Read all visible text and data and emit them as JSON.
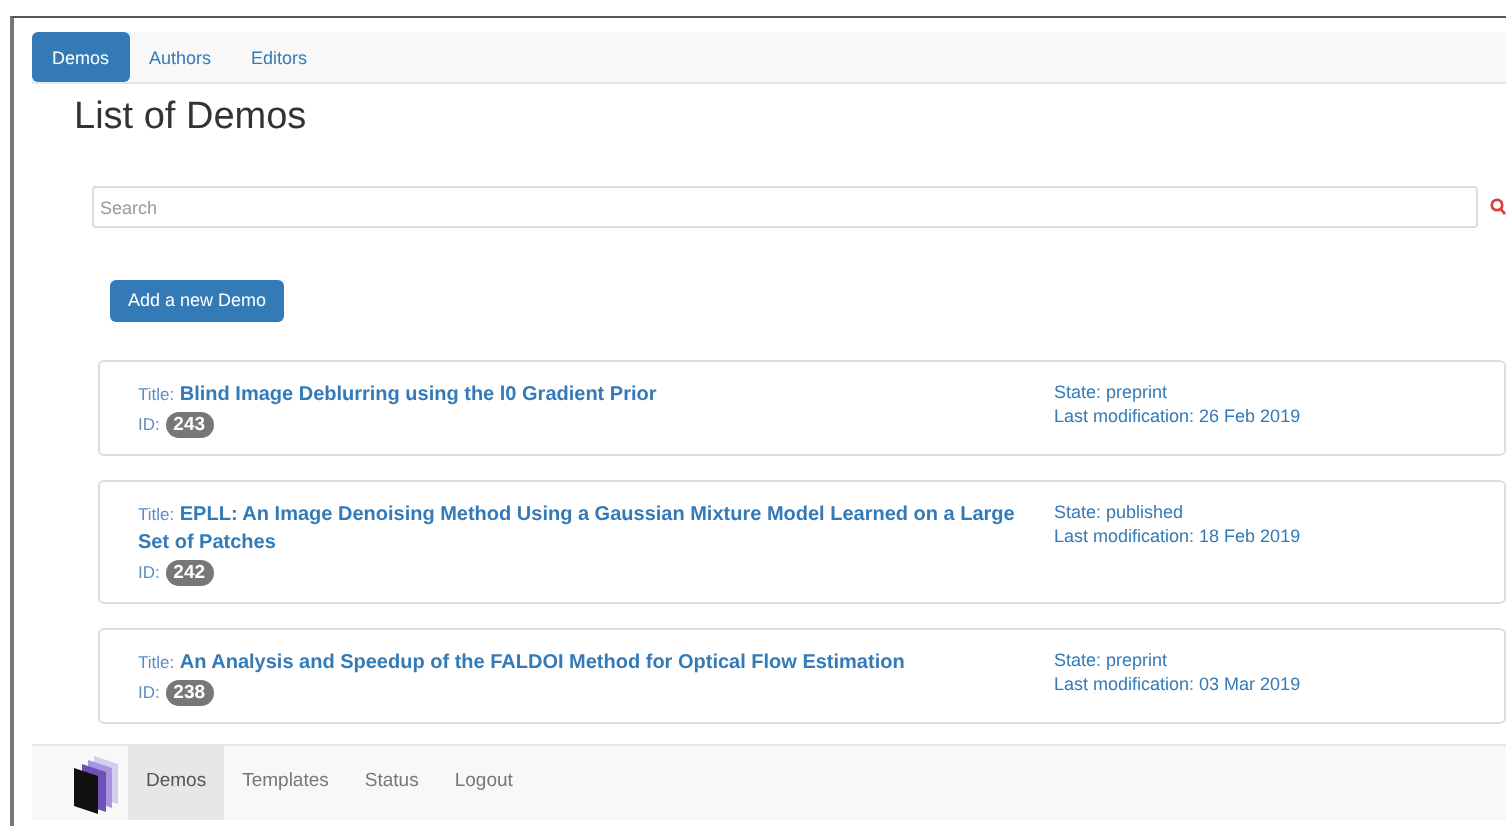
{
  "tabs": [
    {
      "label": "Demos",
      "selected": true
    },
    {
      "label": "Authors",
      "selected": false
    },
    {
      "label": "Editors",
      "selected": false
    }
  ],
  "heading": "List of Demos",
  "search": {
    "placeholder": "Search"
  },
  "add_button": "Add a new Demo",
  "demos": [
    {
      "title_label": "Title:",
      "title": "Blind Image Deblurring using the l0 Gradient Prior",
      "id_label": "ID:",
      "id": "243",
      "state": "State: preprint",
      "modified": "Last modification: 26 Feb 2019"
    },
    {
      "title_label": "Title:",
      "title": "EPLL: An Image Denoising Method Using a Gaussian Mixture Model Learned on a Large Set of Patches",
      "id_label": "ID:",
      "id": "242",
      "state": "State: published",
      "modified": "Last modification: 18 Feb 2019"
    },
    {
      "title_label": "Title:",
      "title": "An Analysis and Speedup of the FALDOI Method for Optical Flow Estimation",
      "id_label": "ID:",
      "id": "238",
      "state": "State: preprint",
      "modified": "Last modification: 03 Mar 2019"
    }
  ],
  "footer_nav": [
    {
      "label": "Demos",
      "selected": true
    },
    {
      "label": "Templates",
      "selected": false
    },
    {
      "label": "Status",
      "selected": false
    },
    {
      "label": "Logout",
      "selected": false
    }
  ]
}
